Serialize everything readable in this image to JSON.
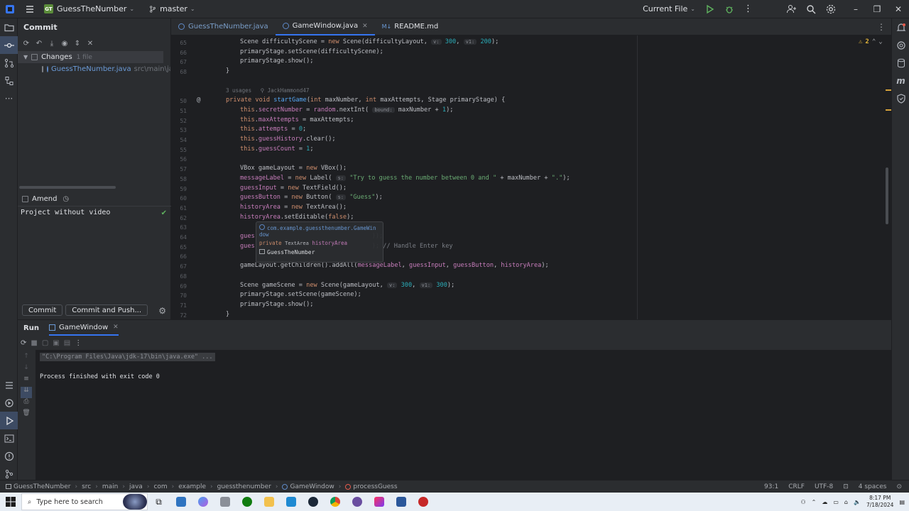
{
  "titlebar": {
    "project_badge": "GT",
    "project": "GuessTheNumber",
    "branch": "master",
    "run_config": "Current File"
  },
  "commit_panel": {
    "title": "Commit",
    "changes_label": "Changes",
    "changes_count": "1 file",
    "file_name": "GuessTheNumber.java",
    "file_path": "src\\main\\java\\com",
    "amend_label": "Amend",
    "message": "Project without video",
    "commit_button": "Commit",
    "commit_push_button": "Commit and Push..."
  },
  "tabs": [
    {
      "label": "GuessTheNumber.java",
      "active": false
    },
    {
      "label": "GameWindow.java",
      "active": true
    },
    {
      "label": "README.md",
      "active": false,
      "prefix": "M↓"
    }
  ],
  "editor": {
    "warnings": "2",
    "usages_hint": "3 usages",
    "author_hint": "JackHammond47",
    "popup": {
      "package": "com.example.guessthenumber.GameWin",
      "package_cont": "dow",
      "field_modifier": "private",
      "field_type": "TextArea",
      "field_name": "historyArea",
      "class_name": "GuessTheNumber"
    },
    "line_numbers": [
      "65",
      "66",
      "67",
      "68",
      "49",
      "50",
      "51",
      "52",
      "53",
      "54",
      "55",
      "56",
      "57",
      "58",
      "59",
      "60",
      "61",
      "62",
      "63",
      "64",
      "65",
      "66",
      "67",
      "68",
      "69",
      "70",
      "71",
      "72"
    ],
    "lines": [
      "Scene difficultyScene = new Scene(difficultyLayout,  v: 300,  v1: 200);",
      "primaryStage.setScene(difficultyScene);",
      "primaryStage.show();",
      "}",
      "private void startGame(int maxNumber, int maxAttempts, Stage primaryStage) {",
      "this.secretNumber = random.nextInt( bound: maxNumber + 1);",
      "this.maxAttempts = maxAttempts;",
      "this.attempts = 0;",
      "this.guessHistory.clear();",
      "this.guessCount = 1;",
      "VBox gameLayout = new VBox();",
      "messageLabel = new Label( s: \"Try to guess the number between 0 and \" + maxNumber + \".\");",
      "guessInput = new TextField();",
      "guessButton = new Button( s: \"Guess\");",
      "historyArea = new TextArea();",
      "historyArea.setEditable(false);",
      "gues",
      "gues",
      "gameLayout.getChildren().addAll(messageLabel, guessInput, guessButton, historyArea);",
      "Scene gameScene = new Scene(gameLayout,  v: 300,  v1: 300);",
      "primaryStage.setScene(gameScene);",
      "primaryStage.show();",
      "}"
    ],
    "line64_tail": "));",
    "line65_tail": "); // Handle Enter key"
  },
  "run_panel": {
    "tab_run": "Run",
    "tab_config": "GameWindow",
    "command": "\"C:\\Program Files\\Java\\jdk-17\\bin\\java.exe\" ...",
    "exit_message": "Process finished with exit code 0"
  },
  "statusbar": {
    "breadcrumbs": [
      "GuessTheNumber",
      "src",
      "main",
      "java",
      "com",
      "example",
      "guessthenumber",
      "GameWindow",
      "processGuess"
    ],
    "position": "93:1",
    "line_sep": "CRLF",
    "encoding": "UTF-8",
    "indent": "4 spaces"
  },
  "taskbar": {
    "search_placeholder": "Type here to search",
    "time": "8:17 PM",
    "date": "7/18/2024"
  },
  "colors": {
    "accent": "#3574f0",
    "keyword": "#cf8e6d",
    "method": "#56a8f5",
    "field": "#c77dbb",
    "number": "#2aacb8",
    "string": "#6aab73"
  }
}
